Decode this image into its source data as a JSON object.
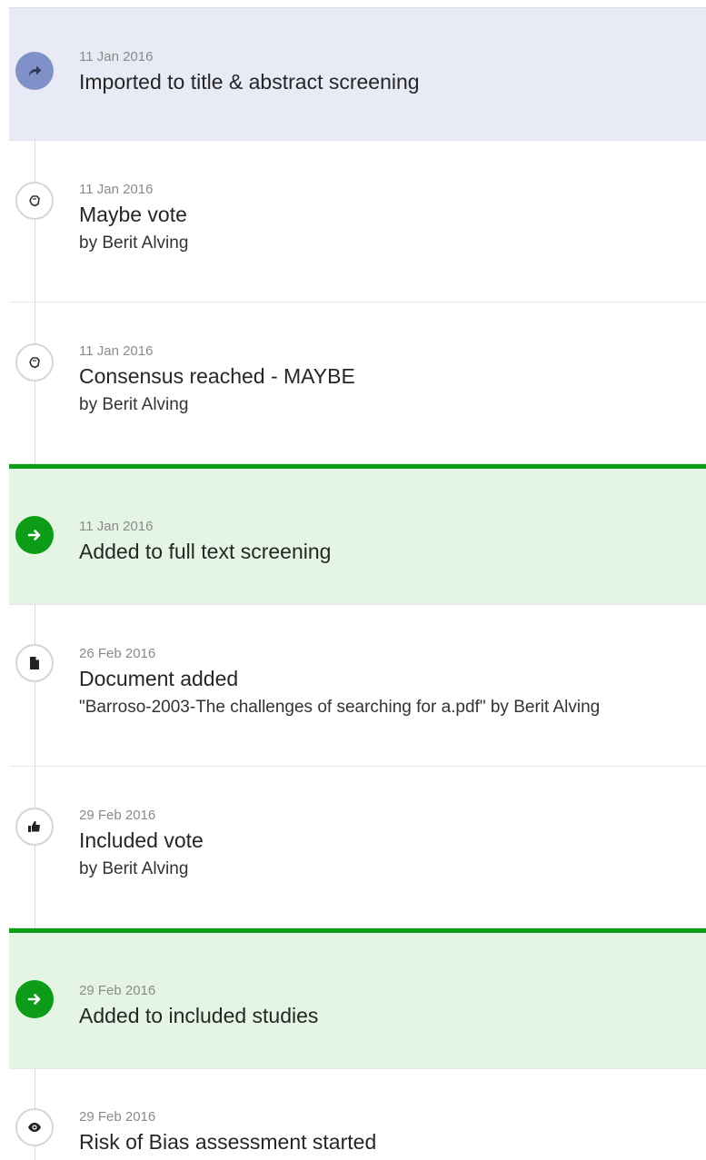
{
  "events": [
    {
      "date": "11 Jan 2016",
      "title": "Imported to title & abstract screening",
      "icon": "share-arrow-icon",
      "style": "stage",
      "accent": "#7f91c8",
      "background": "#e8ebf5"
    },
    {
      "date": "11 Jan 2016",
      "title": "Maybe vote",
      "sub": "by Berit Alving",
      "icon": "hand-icon",
      "style": "vote"
    },
    {
      "date": "11 Jan 2016",
      "title": "Consensus reached - MAYBE",
      "sub": "by Berit Alving",
      "icon": "hand-icon",
      "style": "vote"
    },
    {
      "date": "11 Jan 2016",
      "title": "Added to full text screening",
      "icon": "arrow-right-icon",
      "style": "stage",
      "accent": "#0c9c18",
      "background": "#e5f5e4"
    },
    {
      "date": "26 Feb 2016",
      "title": "Document added",
      "sub": "\"Barroso-2003-The challenges of searching for a.pdf\" by Berit Alving",
      "icon": "document-icon",
      "style": "document"
    },
    {
      "date": "29 Feb 2016",
      "title": "Included vote",
      "sub": "by Berit Alving",
      "icon": "thumbs-up-icon",
      "style": "vote"
    },
    {
      "date": "29 Feb 2016",
      "title": "Added to included studies",
      "icon": "arrow-right-icon",
      "style": "stage",
      "accent": "#0c9c18",
      "background": "#e5f5e4"
    },
    {
      "date": "29 Feb 2016",
      "title": "Risk of Bias assessment started",
      "icon": "eye-icon",
      "style": "assessment"
    }
  ]
}
